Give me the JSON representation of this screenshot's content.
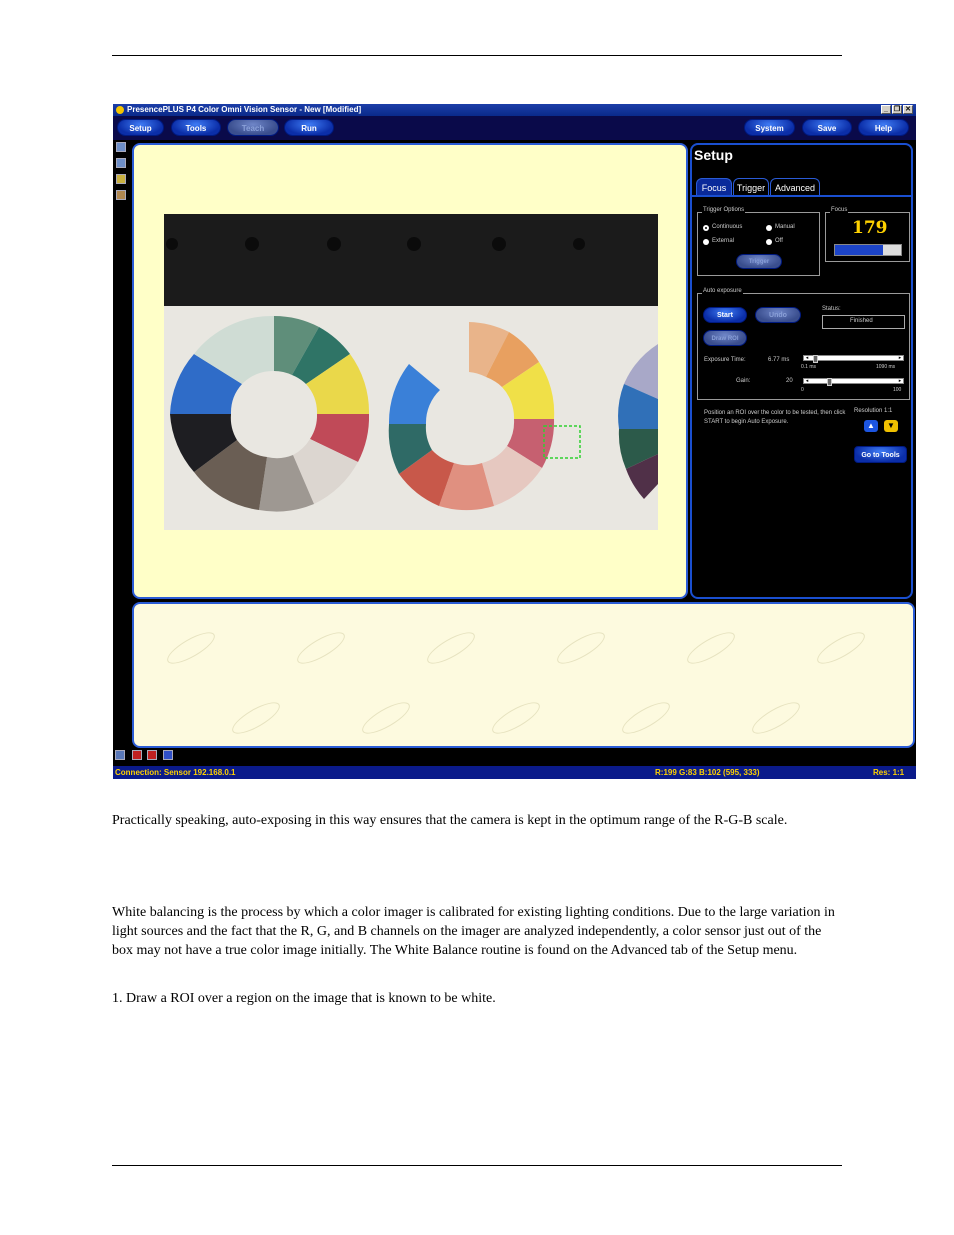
{
  "app": {
    "title": "PresencePLUS  P4 Color Omni Vision Sensor - New [Modified]",
    "window_buttons": [
      "_",
      "❐",
      "✕"
    ],
    "menu": {
      "setup": "Setup",
      "tools": "Tools",
      "teach": "Teach",
      "run": "Run",
      "system": "System",
      "save": "Save",
      "help": "Help"
    },
    "setup_panel": {
      "header": "Setup",
      "tabs": [
        "Focus",
        "Trigger",
        "Advanced"
      ],
      "trigger_options": {
        "label": "Trigger Options",
        "continuous": "Continuous",
        "manual": "Manual",
        "external": "External",
        "off": "Off",
        "trigger_button": "Trigger"
      },
      "focus": {
        "label": "Focus",
        "value": "179",
        "bar_fraction": 0.72
      },
      "auto_exposure": {
        "label": "Auto exposure",
        "start": "Start",
        "undo": "Undo",
        "draw_roi": "Draw ROI",
        "status_label": "Status:",
        "status_value": "Finished",
        "exposure_label": "Exposure Time:",
        "exposure_value": "6.77 ms",
        "exposure_min": "0.1 ms",
        "exposure_max": "1090 ms",
        "exposure_fraction": 0.03,
        "gain_label": "Gain:",
        "gain_value": "20",
        "gain_min": "0",
        "gain_max": "100",
        "gain_fraction": 0.2
      },
      "instruction": "Position an ROI over the color to be tested, then click START to begin Auto Exposure.",
      "resolution_label": "Resolution  1:1",
      "go_to_tools": "Go to Tools"
    },
    "status": {
      "connection": "Connection: Sensor 192.168.0.1",
      "rgb": "R:199  G:83  B:102   (595, 333)",
      "res": "Res:  1:1"
    },
    "colors": {
      "accent": "#2a5bd6",
      "image_bg": "#ffffc8",
      "status_text": "#ffd200",
      "menu_bg": "#0a0a4a"
    }
  },
  "document": {
    "para1": "Practically speaking, auto-exposing in this way ensures that the camera is kept in the optimum range of the R-G-B scale.",
    "para2": "White balancing  is the process by which a color imager is calibrated for existing lighting conditions. Due to the large variation in light sources and the fact that the R, G, and B channels on the imager are analyzed independently, a color sensor just out of the box may not have a true color image initially. The White Balance routine is found on the Advanced tab of the Setup menu.",
    "step1": "1.  Draw a ROI over a region on the image that is known to be white."
  }
}
